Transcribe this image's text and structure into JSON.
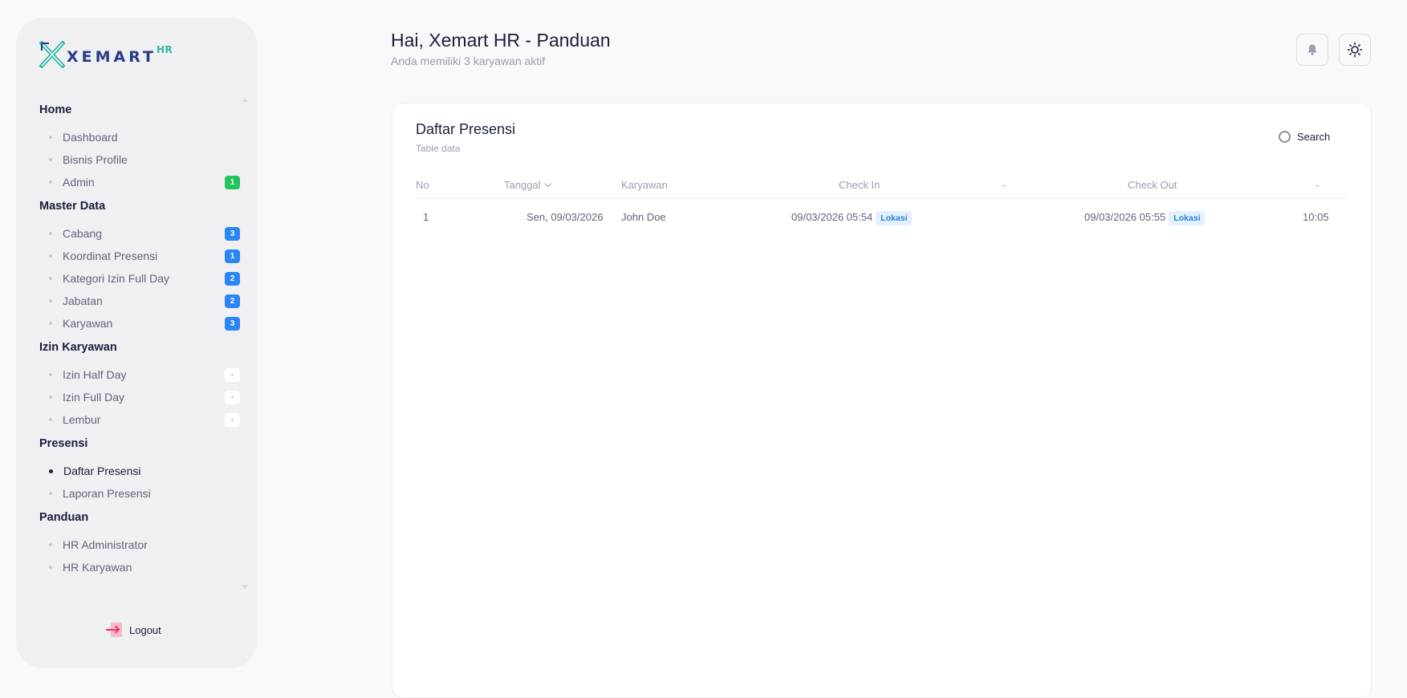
{
  "brand": {
    "name": "XEMART",
    "suffix": "HR"
  },
  "sidebar": {
    "groups": [
      {
        "title": "Home",
        "items": [
          {
            "label": "Dashboard",
            "badge": ""
          },
          {
            "label": "Bisnis Profile",
            "badge": ""
          },
          {
            "label": "Admin",
            "badge": "1"
          }
        ]
      },
      {
        "title": "Master Data",
        "items": [
          {
            "label": "Cabang",
            "badge": "3"
          },
          {
            "label": "Koordinat Presensi",
            "badge": "1"
          },
          {
            "label": "Kategori Izin Full Day",
            "badge": "2"
          },
          {
            "label": "Jabatan",
            "badge": "2"
          },
          {
            "label": "Karyawan",
            "badge": "3"
          }
        ]
      },
      {
        "title": "Izin Karyawan",
        "items": [
          {
            "label": "Izin Half Day",
            "badge": "-"
          },
          {
            "label": "Izin Full Day",
            "badge": "-"
          },
          {
            "label": "Lembur",
            "badge": "-"
          }
        ]
      },
      {
        "title": "Presensi",
        "items": [
          {
            "label": "Daftar Presensi",
            "badge": ""
          },
          {
            "label": "Laporan Presensi",
            "badge": ""
          }
        ]
      },
      {
        "title": "Panduan",
        "items": [
          {
            "label": "HR Administrator",
            "badge": ""
          },
          {
            "label": "HR Karyawan",
            "badge": ""
          }
        ]
      }
    ],
    "active_item": "Daftar Presensi",
    "logout_label": "Logout"
  },
  "header": {
    "title": "Hai, Xemart HR - Panduan",
    "subtitle": "Anda memiliki 3 karyawan aktif",
    "icons": [
      "bell-icon",
      "sun-icon"
    ]
  },
  "card": {
    "title": "Daftar Presensi",
    "subtitle": "Table data",
    "search_label": "Search",
    "columns": [
      "No",
      "Tanggal",
      "Karyawan",
      "Check In",
      "-",
      "Check Out",
      "-"
    ],
    "rows": [
      {
        "no": "1",
        "tanggal": "Sen, 09/03/2026",
        "karyawan": "John Doe",
        "check_in": "09/03/2026 05:54",
        "check_in_tag": "Lokasi",
        "check_out": "09/03/2026 05:55",
        "check_out_tag": "Lokasi",
        "duration": "10:05"
      }
    ]
  },
  "colors": {
    "badge_blue": "#2a86f5",
    "badge_green": "#21c45a",
    "tag_bg": "#e3f1ff",
    "tag_text": "#2a7fd8",
    "logout_accent": "#e3345f"
  }
}
